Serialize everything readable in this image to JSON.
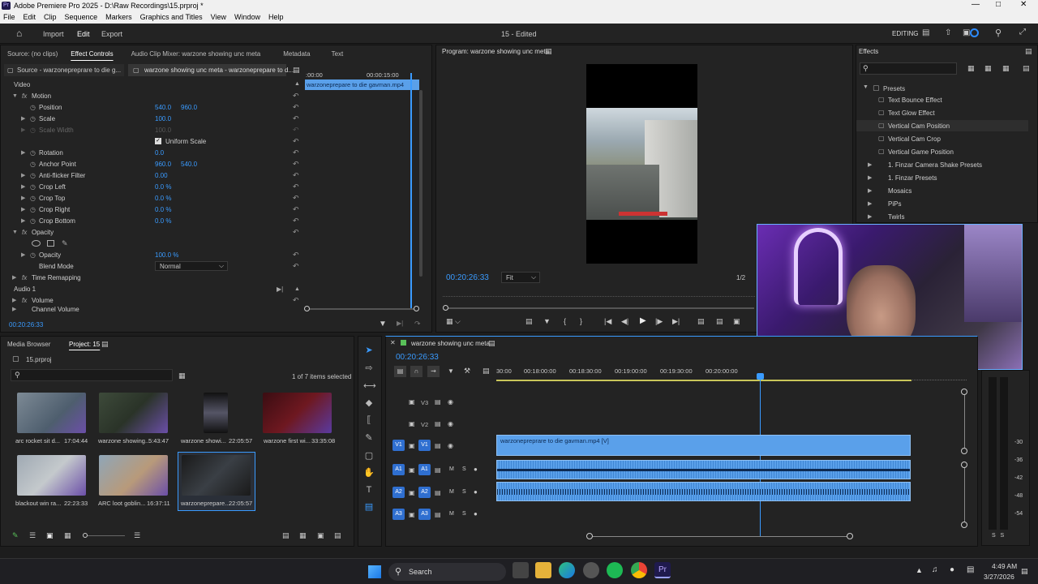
{
  "window": {
    "title": "Adobe Premiere Pro 2025 - D:\\Raw Recordings\\15.prproj *",
    "badge": "Pr"
  },
  "menu": [
    "File",
    "Edit",
    "Clip",
    "Sequence",
    "Markers",
    "Graphics and Titles",
    "View",
    "Window",
    "Help"
  ],
  "workspace": {
    "tabs": [
      "Import",
      "Edit",
      "Export"
    ],
    "active": "Edit",
    "project_title": "15 - Edited",
    "mode_label": "EDITING"
  },
  "effect_controls": {
    "tabs": [
      "Source: (no clips)",
      "Effect Controls",
      "Audio Clip Mixer: warzone showing unc meta",
      "Metadata",
      "Text"
    ],
    "source_clip": "Source - warzonepreprare to die g...",
    "sequence_clip": "warzone showing unc meta - warzoneprepare to d...",
    "mini_ruler_start": ":00:00",
    "mini_ruler_mid": "00:00:15:00",
    "mini_clip_label": "warzoneprepare to die gavman.mp4",
    "section_video": "Video",
    "rows": {
      "motion": "Motion",
      "position": "Position",
      "position_x": "540.0",
      "position_y": "960.0",
      "scale": "Scale",
      "scale_v": "100.0",
      "scale_width": "Scale Width",
      "scale_width_v": "100.0",
      "uniform_scale": "Uniform Scale",
      "rotation": "Rotation",
      "rotation_v": "0.0",
      "anchor": "Anchor Point",
      "anchor_x": "960.0",
      "anchor_y": "540.0",
      "antiflicker": "Anti-flicker Filter",
      "antiflicker_v": "0.00",
      "crop_left": "Crop Left",
      "crop_left_v": "0.0 %",
      "crop_top": "Crop Top",
      "crop_top_v": "0.0 %",
      "crop_right": "Crop Right",
      "crop_right_v": "0.0 %",
      "crop_bottom": "Crop Bottom",
      "crop_bottom_v": "0.0 %",
      "opacity_section": "Opacity",
      "opacity": "Opacity",
      "opacity_v": "100.0 %",
      "blend_mode": "Blend Mode",
      "blend_mode_v": "Normal",
      "time_remap": "Time Remapping",
      "audio": "Audio 1",
      "volume": "Volume",
      "channel_volume": "Channel Volume"
    },
    "timecode": "00:20:26:33"
  },
  "program": {
    "title": "Program: warzone showing unc meta",
    "timecode": "00:20:26:33",
    "fit": "Fit",
    "resolution": "1/2"
  },
  "effects": {
    "title": "Effects",
    "presets_folder": "Presets",
    "items": [
      "Text Bounce Effect",
      "Text Glow Effect",
      "Vertical Cam Position",
      "Vertical Cam Crop",
      "Vertical Game Position"
    ],
    "folders": [
      "1. Finzar Camera Shake Presets",
      "1. Finzar Presets",
      "Mosaics",
      "PiPs",
      "Twirls"
    ]
  },
  "project": {
    "tabs": [
      "Media Browser",
      "Project: 15"
    ],
    "file": "15.prproj",
    "selection": "1 of 7 items selected",
    "clips": [
      {
        "name": "arc rocket sit d...",
        "dur": "17:04:44"
      },
      {
        "name": "warzone showing...",
        "dur": "5:43:47"
      },
      {
        "name": "warzone showi...",
        "dur": "22:05:57"
      },
      {
        "name": "warzone first wi...",
        "dur": "33:35:08"
      },
      {
        "name": "blackout win ra...",
        "dur": "22:23:33"
      },
      {
        "name": "ARC loot goblin...",
        "dur": "16:37:11"
      },
      {
        "name": "warzoneprepare...",
        "dur": "22:05:57"
      }
    ]
  },
  "timeline": {
    "sequence": "warzone showing unc meta",
    "timecode": "00:20:26:33",
    "ruler": [
      "30:00",
      "00:18:00:00",
      "00:18:30:00",
      "00:19:00:00",
      "00:19:30:00",
      "00:20:00:00"
    ],
    "tracks": [
      "V3",
      "V2",
      "V1",
      "A1",
      "A2",
      "A3"
    ],
    "video_clip": "warzonepreprare to die gavman.mp4 [V]",
    "meter_ticks": [
      "-30",
      "-36",
      "-42",
      "-48",
      "-54"
    ],
    "meter_bottom": "S   S"
  },
  "taskbar": {
    "search": "Search",
    "time": "4:49 AM",
    "date": "3/27/2026"
  }
}
